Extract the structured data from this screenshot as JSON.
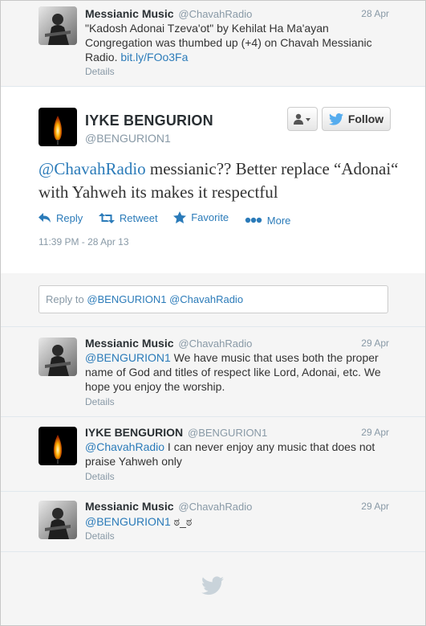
{
  "top_tweet": {
    "name": "Messianic Music",
    "handle": "@ChavahRadio",
    "date": "28 Apr",
    "text": "\"Kadosh Adonai Tzeva'ot\" by Kehilat Ha Ma'ayan Congregation was thumbed up (+4) on Chavah Messianic Radio.",
    "link": "bit.ly/FOo3Fa",
    "details": "Details"
  },
  "main_tweet": {
    "name": "IYKE BENGURION",
    "handle": "@BENGURION1",
    "mention": "@ChavahRadio",
    "text": " messianic?? Better replace “Adonai“ with Yahweh its makes it respectful",
    "timestamp": "11:39 PM - 28 Apr 13",
    "follow_label": "Follow",
    "actions": {
      "reply": "Reply",
      "retweet": "Retweet",
      "favorite": "Favorite",
      "more": "More"
    }
  },
  "reply": {
    "prefix": "Reply to ",
    "mentions": "@BENGURION1 @ChavahRadio"
  },
  "replies": [
    {
      "name": "Messianic Music",
      "handle": "@ChavahRadio",
      "date": "29 Apr",
      "mention": "@BENGURION1",
      "text": " We have music that uses both the proper name of God and titles of respect like Lord, Adonai, etc. We hope you enjoy the worship.",
      "details": "Details"
    },
    {
      "name": "IYKE BENGURION",
      "handle": "@BENGURION1",
      "date": "29 Apr",
      "mention": "@ChavahRadio",
      "text": " I can never enjoy any music that does not praise Yahweh only",
      "details": "Details"
    },
    {
      "name": "Messianic Music",
      "handle": "@ChavahRadio",
      "date": "29 Apr",
      "mention": "@BENGURION1",
      "text": " ಠ_ಠ",
      "details": "Details"
    }
  ],
  "colors": {
    "link": "#2b7bb9",
    "muted": "#8899a6",
    "bird": "#c9d3da"
  },
  "icons": [
    "reply-icon",
    "retweet-icon",
    "favorite-icon",
    "more-icon",
    "user-icon",
    "twitter-bird-icon"
  ]
}
